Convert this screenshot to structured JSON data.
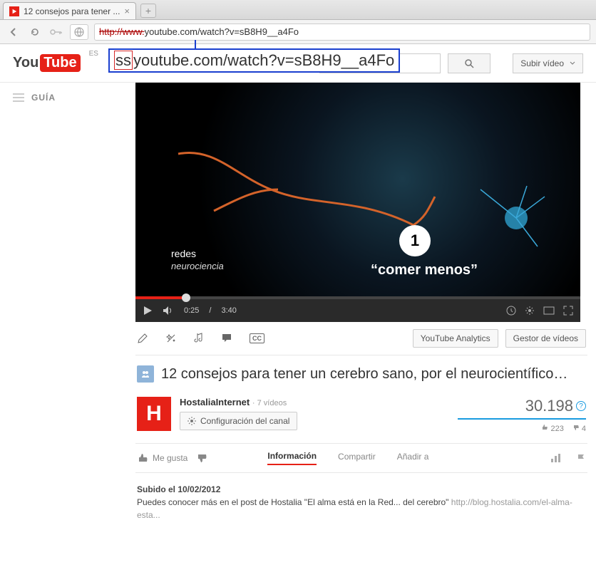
{
  "browser": {
    "tab_title": "12 consejos para tener ...",
    "new_tab": "+",
    "address_prefix_struck": "http://www.",
    "address_rest": "youtube.com/watch?v=sB8H9__a4Fo"
  },
  "overlay": {
    "ss": "ss",
    "rest": "youtube.com/watch?v=sB8H9__a4Fo"
  },
  "masthead": {
    "logo_you": "You",
    "logo_tube": "Tube",
    "country": "ES",
    "search_placeholder": "",
    "upload_label": "Subir vídeo"
  },
  "sidebar": {
    "guide_label": "GUÍA"
  },
  "player": {
    "redes": "redes",
    "neuro": "neurociencia",
    "circle_num": "1",
    "caption": "“comer menos”",
    "time_current": "0:25",
    "time_total": "3:40",
    "cc_label": "CC"
  },
  "actions": {
    "analytics": "YouTube Analytics",
    "manager": "Gestor de vídeos"
  },
  "video": {
    "title": "12 consejos para tener un cerebro sano, por el neurocientífico…",
    "channel": "HostaliaInternet",
    "channel_videos": "7 vídeos",
    "config_channel": "Configuración del canal",
    "views": "30.198",
    "likes": "223",
    "dislikes": "4",
    "me_gusta": "Me gusta"
  },
  "tabs": {
    "info": "Información",
    "share": "Compartir",
    "add": "Añadir a"
  },
  "desc": {
    "uploaded": "Subido el 10/02/2012",
    "text": "Puedes conocer más en el post de Hostalia \"El alma está en la Red... del cerebro\" ",
    "link": "http://blog.hostalia.com/el-alma-esta..."
  }
}
